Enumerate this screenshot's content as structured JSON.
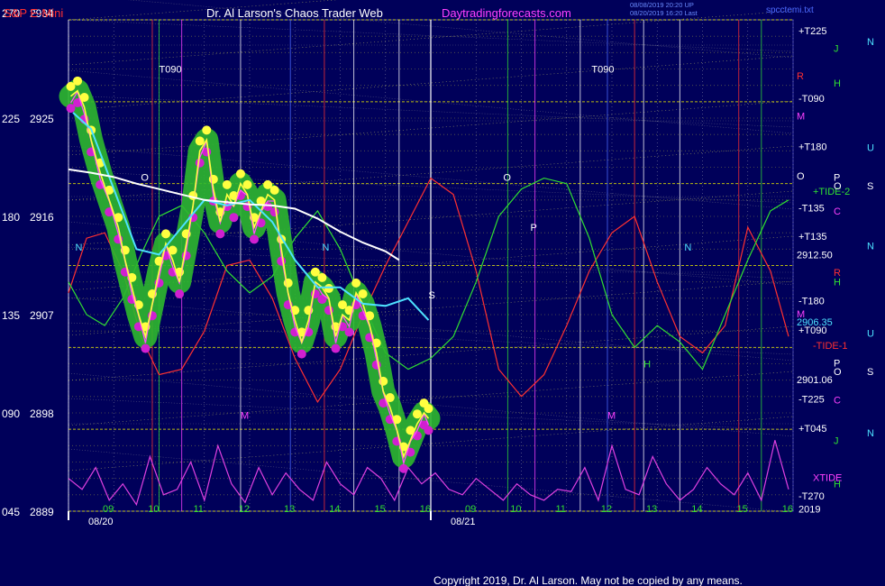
{
  "header": {
    "symbol": "S&P E-Mini",
    "site_title": "Dr. Al Larson's Chaos Trader Web",
    "site_url": "Daytradingforecasts.com",
    "stamp_line1": "08/08/2019 20:20 UP",
    "stamp_line2": "08/20/2019 16:20 Last",
    "filename": "spcctemi.txt"
  },
  "footer": {
    "copyright": "Copyright 2019, Dr. Al Larson. May not be copied by any means."
  },
  "colors": {
    "background": "#00005a",
    "price_glow": "#2db82d",
    "price_line": "#ffff40",
    "price_close_line": "#ff4dff",
    "fast_avg": "#4de1ff",
    "slow_avg": "#ffffff",
    "tide": "#ff3030",
    "xtide": "#e040e0",
    "green_field": "#30e030",
    "grid_yellow": "#e6e600",
    "grid_white": "#d0d0d0"
  },
  "chart_data": {
    "type": "line",
    "title": "",
    "xlabel": "",
    "ylabel": "",
    "ylim": [
      2889,
      2934
    ],
    "left_axis": [
      {
        "angle": "270",
        "price": "2934",
        "value": 2934
      },
      {
        "angle": "225",
        "price": "2925",
        "value": 2925
      },
      {
        "angle": "180",
        "price": "2916",
        "value": 2916
      },
      {
        "angle": "135",
        "price": "2907",
        "value": 2907
      },
      {
        "angle": "090",
        "price": "2898",
        "value": 2898
      },
      {
        "angle": "045",
        "price": "2889",
        "value": 2889
      }
    ],
    "x_hour_ticks": [
      "09",
      "10",
      "11",
      "12",
      "13",
      "14",
      "15",
      "16",
      "09",
      "10",
      "11",
      "12",
      "13",
      "14",
      "15",
      "16"
    ],
    "x_dates": [
      "08/20",
      "08/21"
    ],
    "price_marks": [
      {
        "label": "2912.50",
        "value": 2912.5,
        "color": "#ffffff"
      },
      {
        "label": "2906.35",
        "value": 2906.35,
        "color": "#4de1ff"
      },
      {
        "label": "2901.06",
        "value": 2901.06,
        "color": "#ffffff"
      }
    ],
    "right_labels": [
      {
        "label": "+T225",
        "value": 2933.0,
        "color": "#ffffff"
      },
      {
        "label": "-T090",
        "value": 2926.8,
        "color": "#ffffff"
      },
      {
        "label": "+T180",
        "value": 2922.4,
        "color": "#ffffff"
      },
      {
        "label": "-T135",
        "value": 2916.8,
        "color": "#ffffff"
      },
      {
        "label": "+T135",
        "value": 2914.2,
        "color": "#ffffff"
      },
      {
        "label": "-T180",
        "value": 2908.3,
        "color": "#ffffff"
      },
      {
        "label": "+T090",
        "value": 2905.6,
        "color": "#ffffff"
      },
      {
        "label": "-T225",
        "value": 2899.3,
        "color": "#ffffff"
      },
      {
        "label": "+T045",
        "value": 2896.6,
        "color": "#ffffff"
      },
      {
        "label": "-T270",
        "value": 2890.4,
        "color": "#ffffff"
      },
      {
        "label": "2019",
        "value": 2889.2,
        "color": "#ffffff"
      },
      {
        "label": "+TIDE-2",
        "value": 2918.3,
        "color": "#30e030"
      },
      {
        "label": "-TIDE-1",
        "value": 2904.2,
        "color": "#ff3030"
      },
      {
        "label": "XTIDE",
        "value": 2892.1,
        "color": "#ff40ff"
      }
    ],
    "planet_letters": [
      {
        "label": "N",
        "value": 2932.0,
        "color": "#4de1ff",
        "col": 2
      },
      {
        "label": "J",
        "value": 2931.4,
        "color": "#30e030",
        "col": 1
      },
      {
        "label": "R",
        "value": 2928.9,
        "color": "#ff3030",
        "col": 0
      },
      {
        "label": "H",
        "value": 2928.2,
        "color": "#30e030",
        "col": 1
      },
      {
        "label": "M",
        "value": 2925.2,
        "color": "#ff40ff",
        "col": 0
      },
      {
        "label": "U",
        "value": 2922.3,
        "color": "#4de1ff",
        "col": 2
      },
      {
        "label": "O",
        "value": 2919.7,
        "color": "#ffffff",
        "col": 0
      },
      {
        "label": "P",
        "value": 2919.6,
        "color": "#ffffff",
        "col": 1
      },
      {
        "label": "O",
        "value": 2918.8,
        "color": "#ffffff",
        "col": 1
      },
      {
        "label": "S",
        "value": 2918.8,
        "color": "#ffffff",
        "col": 2
      },
      {
        "label": "C",
        "value": 2916.5,
        "color": "#ff40ff",
        "col": 1
      },
      {
        "label": "N",
        "value": 2913.3,
        "color": "#4de1ff",
        "col": 2
      },
      {
        "label": "R",
        "value": 2910.9,
        "color": "#ff3030",
        "col": 1
      },
      {
        "label": "H",
        "value": 2910.0,
        "color": "#30e030",
        "col": 1
      },
      {
        "label": "M",
        "value": 2907.1,
        "color": "#ff40ff",
        "col": 0
      },
      {
        "label": "U",
        "value": 2905.3,
        "color": "#4de1ff",
        "col": 2
      },
      {
        "label": "P",
        "value": 2902.6,
        "color": "#ffffff",
        "col": 1
      },
      {
        "label": "O",
        "value": 2901.8,
        "color": "#ffffff",
        "col": 1
      },
      {
        "label": "S",
        "value": 2901.8,
        "color": "#ffffff",
        "col": 2
      },
      {
        "label": "C",
        "value": 2899.2,
        "color": "#ff40ff",
        "col": 1
      },
      {
        "label": "N",
        "value": 2896.2,
        "color": "#4de1ff",
        "col": 2
      },
      {
        "label": "J",
        "value": 2895.5,
        "color": "#30e030",
        "col": 1
      },
      {
        "label": "H",
        "value": 2891.5,
        "color": "#30e030",
        "col": 1
      }
    ],
    "in_chart_labels": [
      {
        "label": "T090",
        "hour": 2.0,
        "value": 2929.5,
        "color": "#ffffff"
      },
      {
        "label": "T090",
        "hour": 11.55,
        "value": 2929.5,
        "color": "#ffffff"
      },
      {
        "label": "O",
        "hour": 1.6,
        "value": 2919.6,
        "color": "#ffffff"
      },
      {
        "label": "O",
        "hour": 9.6,
        "value": 2919.6,
        "color": "#ffffff"
      },
      {
        "label": "P",
        "hour": 10.2,
        "value": 2915.0,
        "color": "#ffffff"
      },
      {
        "label": "N",
        "hour": 0.15,
        "value": 2913.2,
        "color": "#4de1ff"
      },
      {
        "label": "N",
        "hour": 5.6,
        "value": 2913.2,
        "color": "#4de1ff"
      },
      {
        "label": "N",
        "hour": 13.6,
        "value": 2913.2,
        "color": "#4de1ff"
      },
      {
        "label": "S",
        "hour": 7.95,
        "value": 2908.8,
        "color": "#ffffff"
      },
      {
        "label": "M",
        "hour": 3.8,
        "value": 2897.8,
        "color": "#ff40ff"
      },
      {
        "label": "M",
        "hour": 11.9,
        "value": 2897.8,
        "color": "#ff40ff"
      },
      {
        "label": "H",
        "hour": 12.7,
        "value": 2902.5,
        "color": "#30e030"
      }
    ],
    "series": [
      {
        "kind": "price",
        "x": [
          0.05,
          0.2,
          0.35,
          0.5,
          0.7,
          0.9,
          1.1,
          1.25,
          1.4,
          1.55,
          1.7,
          1.85,
          2.0,
          2.15,
          2.3,
          2.45,
          2.6,
          2.75,
          2.9,
          3.05,
          3.2,
          3.35,
          3.5,
          3.65,
          3.8,
          3.95,
          4.1,
          4.25,
          4.4,
          4.55,
          4.7,
          4.85,
          5.0,
          5.15,
          5.3,
          5.45,
          5.6,
          5.75,
          5.9,
          6.05,
          6.2,
          6.35,
          6.5,
          6.65,
          6.8,
          6.95,
          7.1,
          7.25,
          7.4,
          7.55,
          7.7,
          7.85,
          7.95
        ],
        "values": [
          2927.0,
          2927.5,
          2926.0,
          2923.0,
          2920.0,
          2917.5,
          2915.0,
          2912.0,
          2909.5,
          2907.0,
          2905.0,
          2908.0,
          2911.0,
          2913.5,
          2912.0,
          2910.0,
          2913.5,
          2917.0,
          2922.0,
          2923.0,
          2918.5,
          2915.5,
          2918.0,
          2917.0,
          2919.0,
          2918.0,
          2915.0,
          2916.5,
          2918.0,
          2917.5,
          2913.0,
          2909.0,
          2906.5,
          2904.5,
          2906.5,
          2910.0,
          2909.5,
          2908.5,
          2905.0,
          2907.0,
          2906.5,
          2909.0,
          2908.0,
          2906.0,
          2903.5,
          2900.0,
          2898.5,
          2896.5,
          2894.0,
          2895.5,
          2897.0,
          2898.0,
          2897.5
        ]
      },
      {
        "kind": "fast_avg",
        "x": [
          0.1,
          0.5,
          1.0,
          1.5,
          2.0,
          2.5,
          3.0,
          3.5,
          4.0,
          4.5,
          5.0,
          5.5,
          6.0,
          6.5,
          7.0,
          7.5,
          7.95
        ],
        "values": [
          2925.5,
          2924.0,
          2918.5,
          2913.0,
          2912.5,
          2915.0,
          2917.5,
          2917.0,
          2917.5,
          2915.5,
          2912.0,
          2909.5,
          2909.5,
          2908.0,
          2907.8,
          2908.5,
          2906.5
        ]
      },
      {
        "kind": "slow_avg",
        "x": [
          0.0,
          0.5,
          1.0,
          1.5,
          2.0,
          2.5,
          3.0,
          3.5,
          4.0,
          4.5,
          5.0,
          5.5,
          6.0,
          6.5,
          7.0,
          7.3
        ],
        "values": [
          2920.3,
          2920.0,
          2919.6,
          2919.0,
          2918.5,
          2918.0,
          2917.5,
          2917.3,
          2917.1,
          2917.0,
          2916.7,
          2915.8,
          2914.6,
          2913.6,
          2912.8,
          2912.0
        ]
      },
      {
        "kind": "tide",
        "x": [
          0.0,
          0.4,
          0.8,
          1.2,
          1.6,
          2.0,
          2.5,
          3.0,
          3.5,
          4.0,
          4.5,
          5.0,
          5.5,
          6.0,
          6.5,
          7.0,
          7.5,
          8.0,
          8.5,
          9.0,
          9.5,
          10.0,
          10.5,
          11.0,
          11.5,
          12.0,
          12.5,
          13.0,
          13.5,
          14.0,
          14.5,
          15.0,
          15.5,
          15.9
        ],
        "values": [
          2909.0,
          2914.0,
          2914.5,
          2911.0,
          2905.0,
          2901.5,
          2902.0,
          2905.5,
          2911.5,
          2912.0,
          2908.5,
          2903.0,
          2899.0,
          2902.0,
          2907.0,
          2911.5,
          2915.5,
          2919.5,
          2918.0,
          2911.0,
          2902.0,
          2899.5,
          2901.5,
          2906.0,
          2911.0,
          2914.5,
          2916.0,
          2910.0,
          2905.0,
          2903.5,
          2906.0,
          2915.0,
          2911.0,
          2905.0
        ]
      },
      {
        "kind": "tide2",
        "x": [
          0.0,
          0.4,
          0.8,
          1.2,
          1.6,
          2.0,
          2.5,
          3.0,
          3.5,
          4.0,
          4.5,
          5.0,
          5.5,
          6.0,
          6.5,
          7.0,
          7.5,
          8.0,
          8.5,
          9.0,
          9.5,
          10.0,
          10.5,
          11.0,
          11.5,
          12.0,
          12.5,
          13.0,
          13.5,
          14.0,
          14.5,
          15.0,
          15.5,
          15.9
        ],
        "values": [
          2910.0,
          2907.0,
          2906.0,
          2908.5,
          2912.5,
          2916.0,
          2917.0,
          2914.5,
          2911.0,
          2909.0,
          2910.5,
          2914.0,
          2916.5,
          2913.0,
          2908.0,
          2903.5,
          2902.0,
          2903.0,
          2905.0,
          2910.0,
          2916.0,
          2918.5,
          2919.5,
          2919.0,
          2914.0,
          2907.0,
          2904.0,
          2906.0,
          2904.5,
          2902.0,
          2907.0,
          2912.0,
          2916.5,
          2917.5
        ]
      },
      {
        "kind": "xtide",
        "x": [
          0.0,
          0.3,
          0.6,
          0.9,
          1.2,
          1.5,
          1.8,
          2.1,
          2.4,
          2.7,
          3.0,
          3.3,
          3.6,
          3.9,
          4.2,
          4.5,
          4.8,
          5.1,
          5.4,
          5.7,
          6.0,
          6.3,
          6.6,
          6.9,
          7.2,
          7.5,
          7.8,
          8.1,
          8.4,
          8.7,
          9.0,
          9.3,
          9.6,
          9.9,
          10.2,
          10.5,
          10.8,
          11.1,
          11.4,
          11.7,
          12.0,
          12.3,
          12.6,
          12.9,
          13.2,
          13.5,
          13.8,
          14.1,
          14.4,
          14.7,
          15.0,
          15.3,
          15.6,
          15.9
        ],
        "values": [
          2892.0,
          2891.0,
          2893.0,
          2890.0,
          2891.5,
          2889.6,
          2894.0,
          2890.5,
          2891.0,
          2893.5,
          2890.0,
          2895.0,
          2891.5,
          2889.8,
          2893.0,
          2890.5,
          2892.5,
          2891.0,
          2890.0,
          2893.5,
          2891.5,
          2890.5,
          2893.0,
          2892.0,
          2890.0,
          2893.0,
          2891.5,
          2892.5,
          2891.0,
          2890.5,
          2892.0,
          2891.0,
          2890.0,
          2891.5,
          2890.5,
          2890.0,
          2891.0,
          2890.8,
          2893.0,
          2890.0,
          2895.0,
          2891.0,
          2890.5,
          2894.0,
          2891.5,
          2890.0,
          2891.0,
          2893.0,
          2891.5,
          2890.5,
          2892.5,
          2890.0,
          2895.5,
          2891.0
        ]
      }
    ]
  }
}
